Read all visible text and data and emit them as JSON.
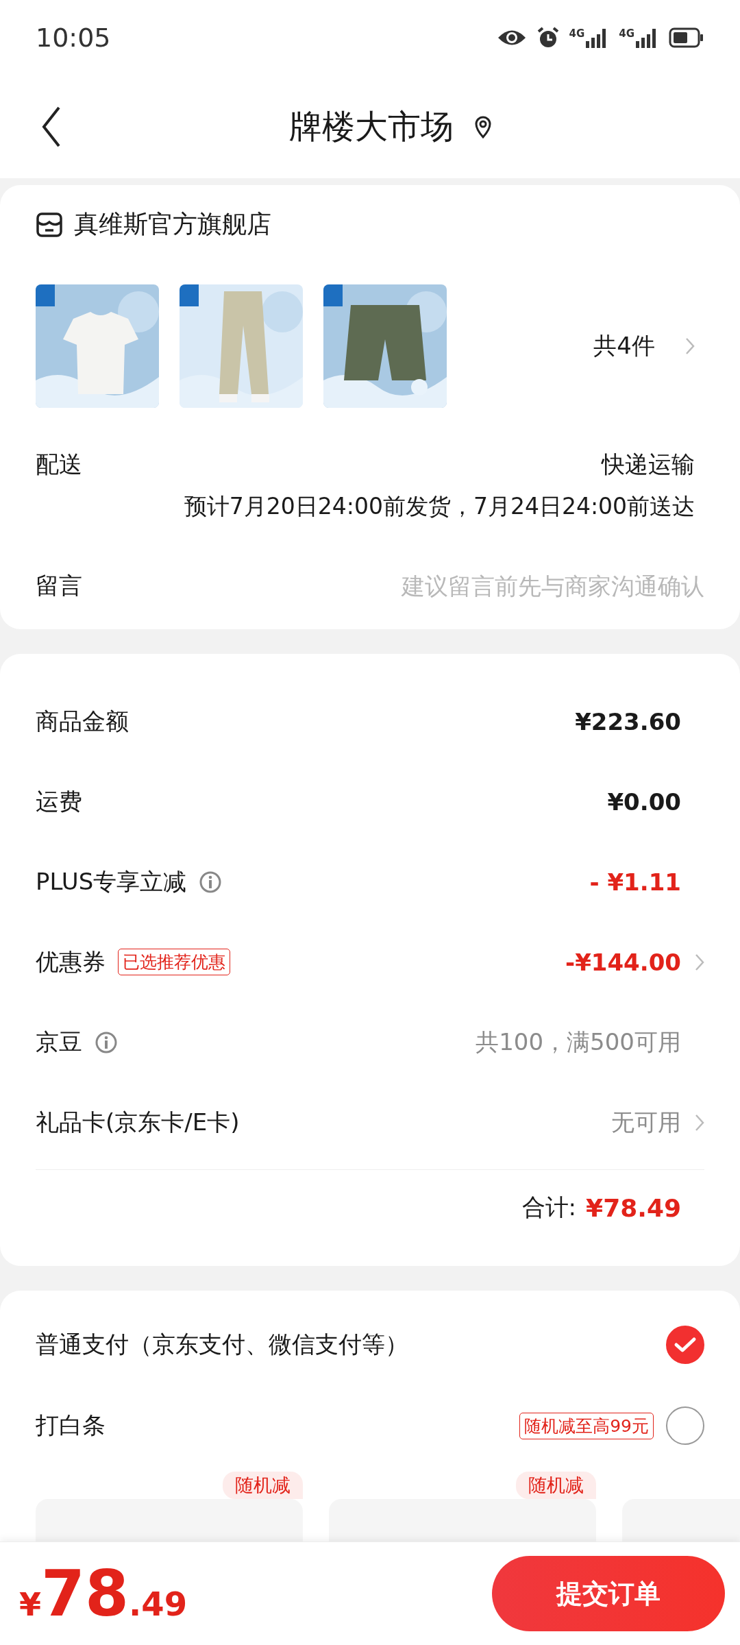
{
  "status_bar": {
    "time": "10:05",
    "network_1": "4G",
    "network_2": "4G"
  },
  "header": {
    "title": "牌楼大市场"
  },
  "store": {
    "name": "真维斯官方旗舰店",
    "count": "共4件"
  },
  "delivery": {
    "label": "配送",
    "method": "快递运输",
    "estimate": "预计7月20日24:00前发货，7月24日24:00前送达"
  },
  "message": {
    "label": "留言",
    "placeholder": "建议留言前先与商家沟通确认"
  },
  "costs": [
    {
      "label": "商品金额",
      "info": false,
      "value": "¥223.60",
      "kind": "amount",
      "color": "#1a1a1a",
      "arrow": false
    },
    {
      "label": "运费",
      "info": false,
      "value": "¥0.00",
      "kind": "amount",
      "color": "#1a1a1a",
      "arrow": false
    },
    {
      "label": "PLUS专享立减",
      "info": true,
      "value": "- ¥1.11",
      "kind": "amount",
      "color": "#e2231a",
      "arrow": false
    },
    {
      "label": "优惠券",
      "info": false,
      "tag": "已选推荐优惠",
      "value": "-¥144.00",
      "kind": "amount",
      "color": "#e2231a",
      "arrow": true
    },
    {
      "label": "京豆",
      "info": true,
      "value": "共100，满500可用",
      "kind": "note",
      "color": "#8c8c8c",
      "arrow": false
    },
    {
      "label": "礼品卡(京东卡/E卡)",
      "info": false,
      "value": "无可用",
      "kind": "note",
      "color": "#8c8c8c",
      "arrow": true
    }
  ],
  "total": {
    "label": "合计:",
    "value": "¥78.49"
  },
  "payment": [
    {
      "label": "普通支付（京东支付、微信支付等）",
      "selected": true
    },
    {
      "label": "打白条",
      "tag": "随机减至高99元",
      "selected": false
    }
  ],
  "installments": [
    {
      "kind": "offer",
      "badge": "随机减"
    },
    {
      "kind": "offer",
      "badge": "随机减"
    },
    {
      "kind": "plain"
    }
  ],
  "footer": {
    "currency": "¥",
    "amount_int": "78",
    "amount_dec": ".49",
    "submit": "提交订单"
  }
}
